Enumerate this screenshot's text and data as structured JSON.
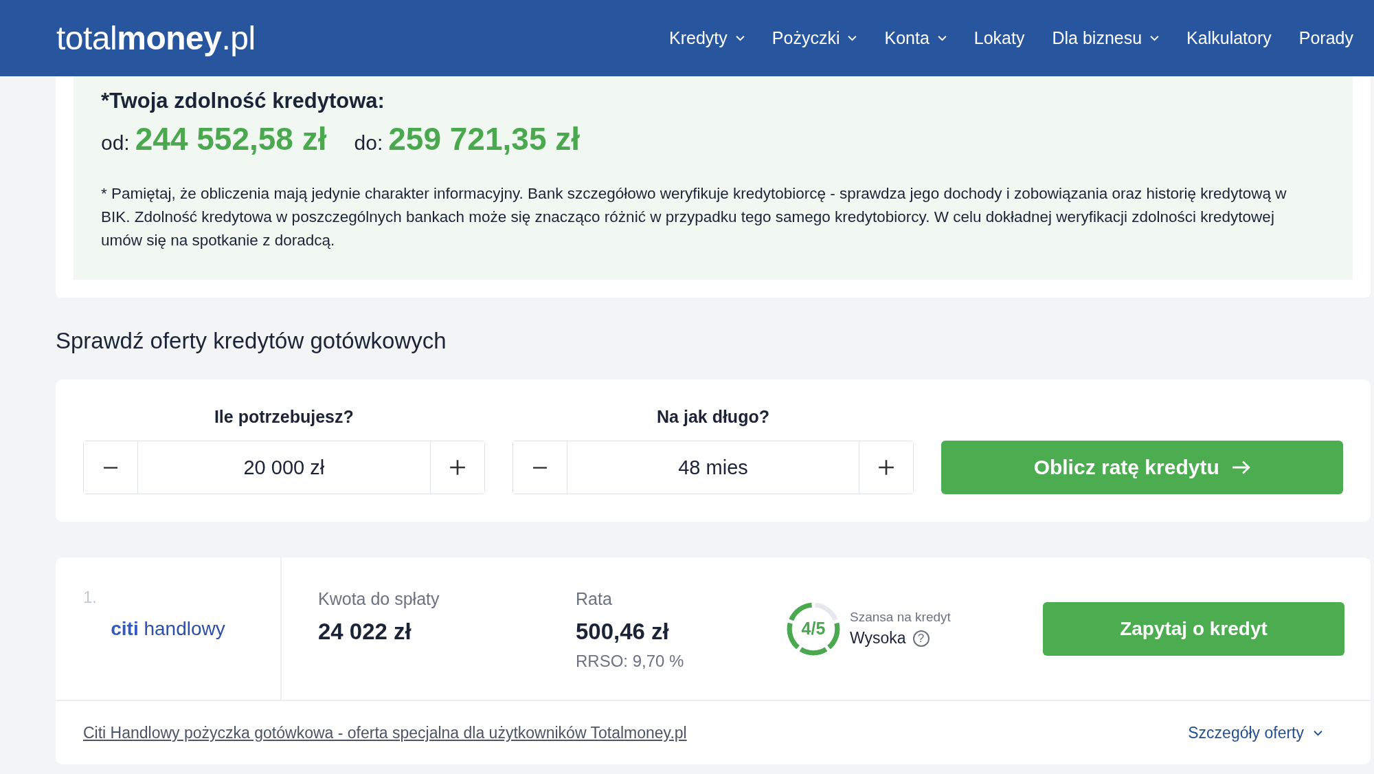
{
  "header": {
    "logo": "total**money**.pl",
    "nav": [
      {
        "label": "Kredyty",
        "dropdown": true
      },
      {
        "label": "Pożyczki",
        "dropdown": true
      },
      {
        "label": "Konta",
        "dropdown": true
      },
      {
        "label": "Lokaty",
        "dropdown": false
      },
      {
        "label": "Dla biznesu",
        "dropdown": true
      },
      {
        "label": "Kalkulatory",
        "dropdown": false
      },
      {
        "label": "Porady",
        "dropdown": false
      }
    ]
  },
  "capacity": {
    "title": "*Twoja zdolność kredytowa:",
    "from_label": "od:",
    "from_value": "244 552,58 zł",
    "to_label": "do:",
    "to_value": "259 721,35 zł",
    "note": "* Pamiętaj, że obliczenia mają jedynie charakter informacyjny. Bank szczegółowo weryfikuje kredytobiorcę - sprawdza jego dochody i zobowiązania oraz historię kredytową w BIK. Zdolność kredytowa w poszczególnych bankach może się znacząco różnić w przypadku tego samego kredytobiorcy. W celu dokładnej weryfikacji zdolności kredytowej umów się na spotkanie z doradcą."
  },
  "offers_heading": "Sprawdź oferty kredytów gotówkowych",
  "calculator": {
    "fields": [
      {
        "label": "Ile potrzebujesz?",
        "value": "20 000 zł"
      },
      {
        "label": "Na jak długo?",
        "value": "48 mies"
      }
    ],
    "button": "Oblicz ratę kredytu"
  },
  "offers": [
    {
      "rank": "1.",
      "bank_logo": "**citi** handlowy",
      "amount_label": "Kwota do spłaty",
      "amount_value": "24 022 zł",
      "installment_label": "Rata",
      "installment_value": "500,46 zł",
      "rrso": "RRSO: 9,70 %",
      "chance_score": "4/5",
      "level": 0.8,
      "chance_label": "Szansa na kredyt",
      "chance_value": "Wysoka",
      "help": "?",
      "button": "Zapytaj o kredyt",
      "link": "Citi Handlowy pożyczka gotówkowa - oferta specjalna dla użytkowników Totalmoney.pl",
      "details": "Szczegóły oferty",
      "expanded": false
    }
  ]
}
